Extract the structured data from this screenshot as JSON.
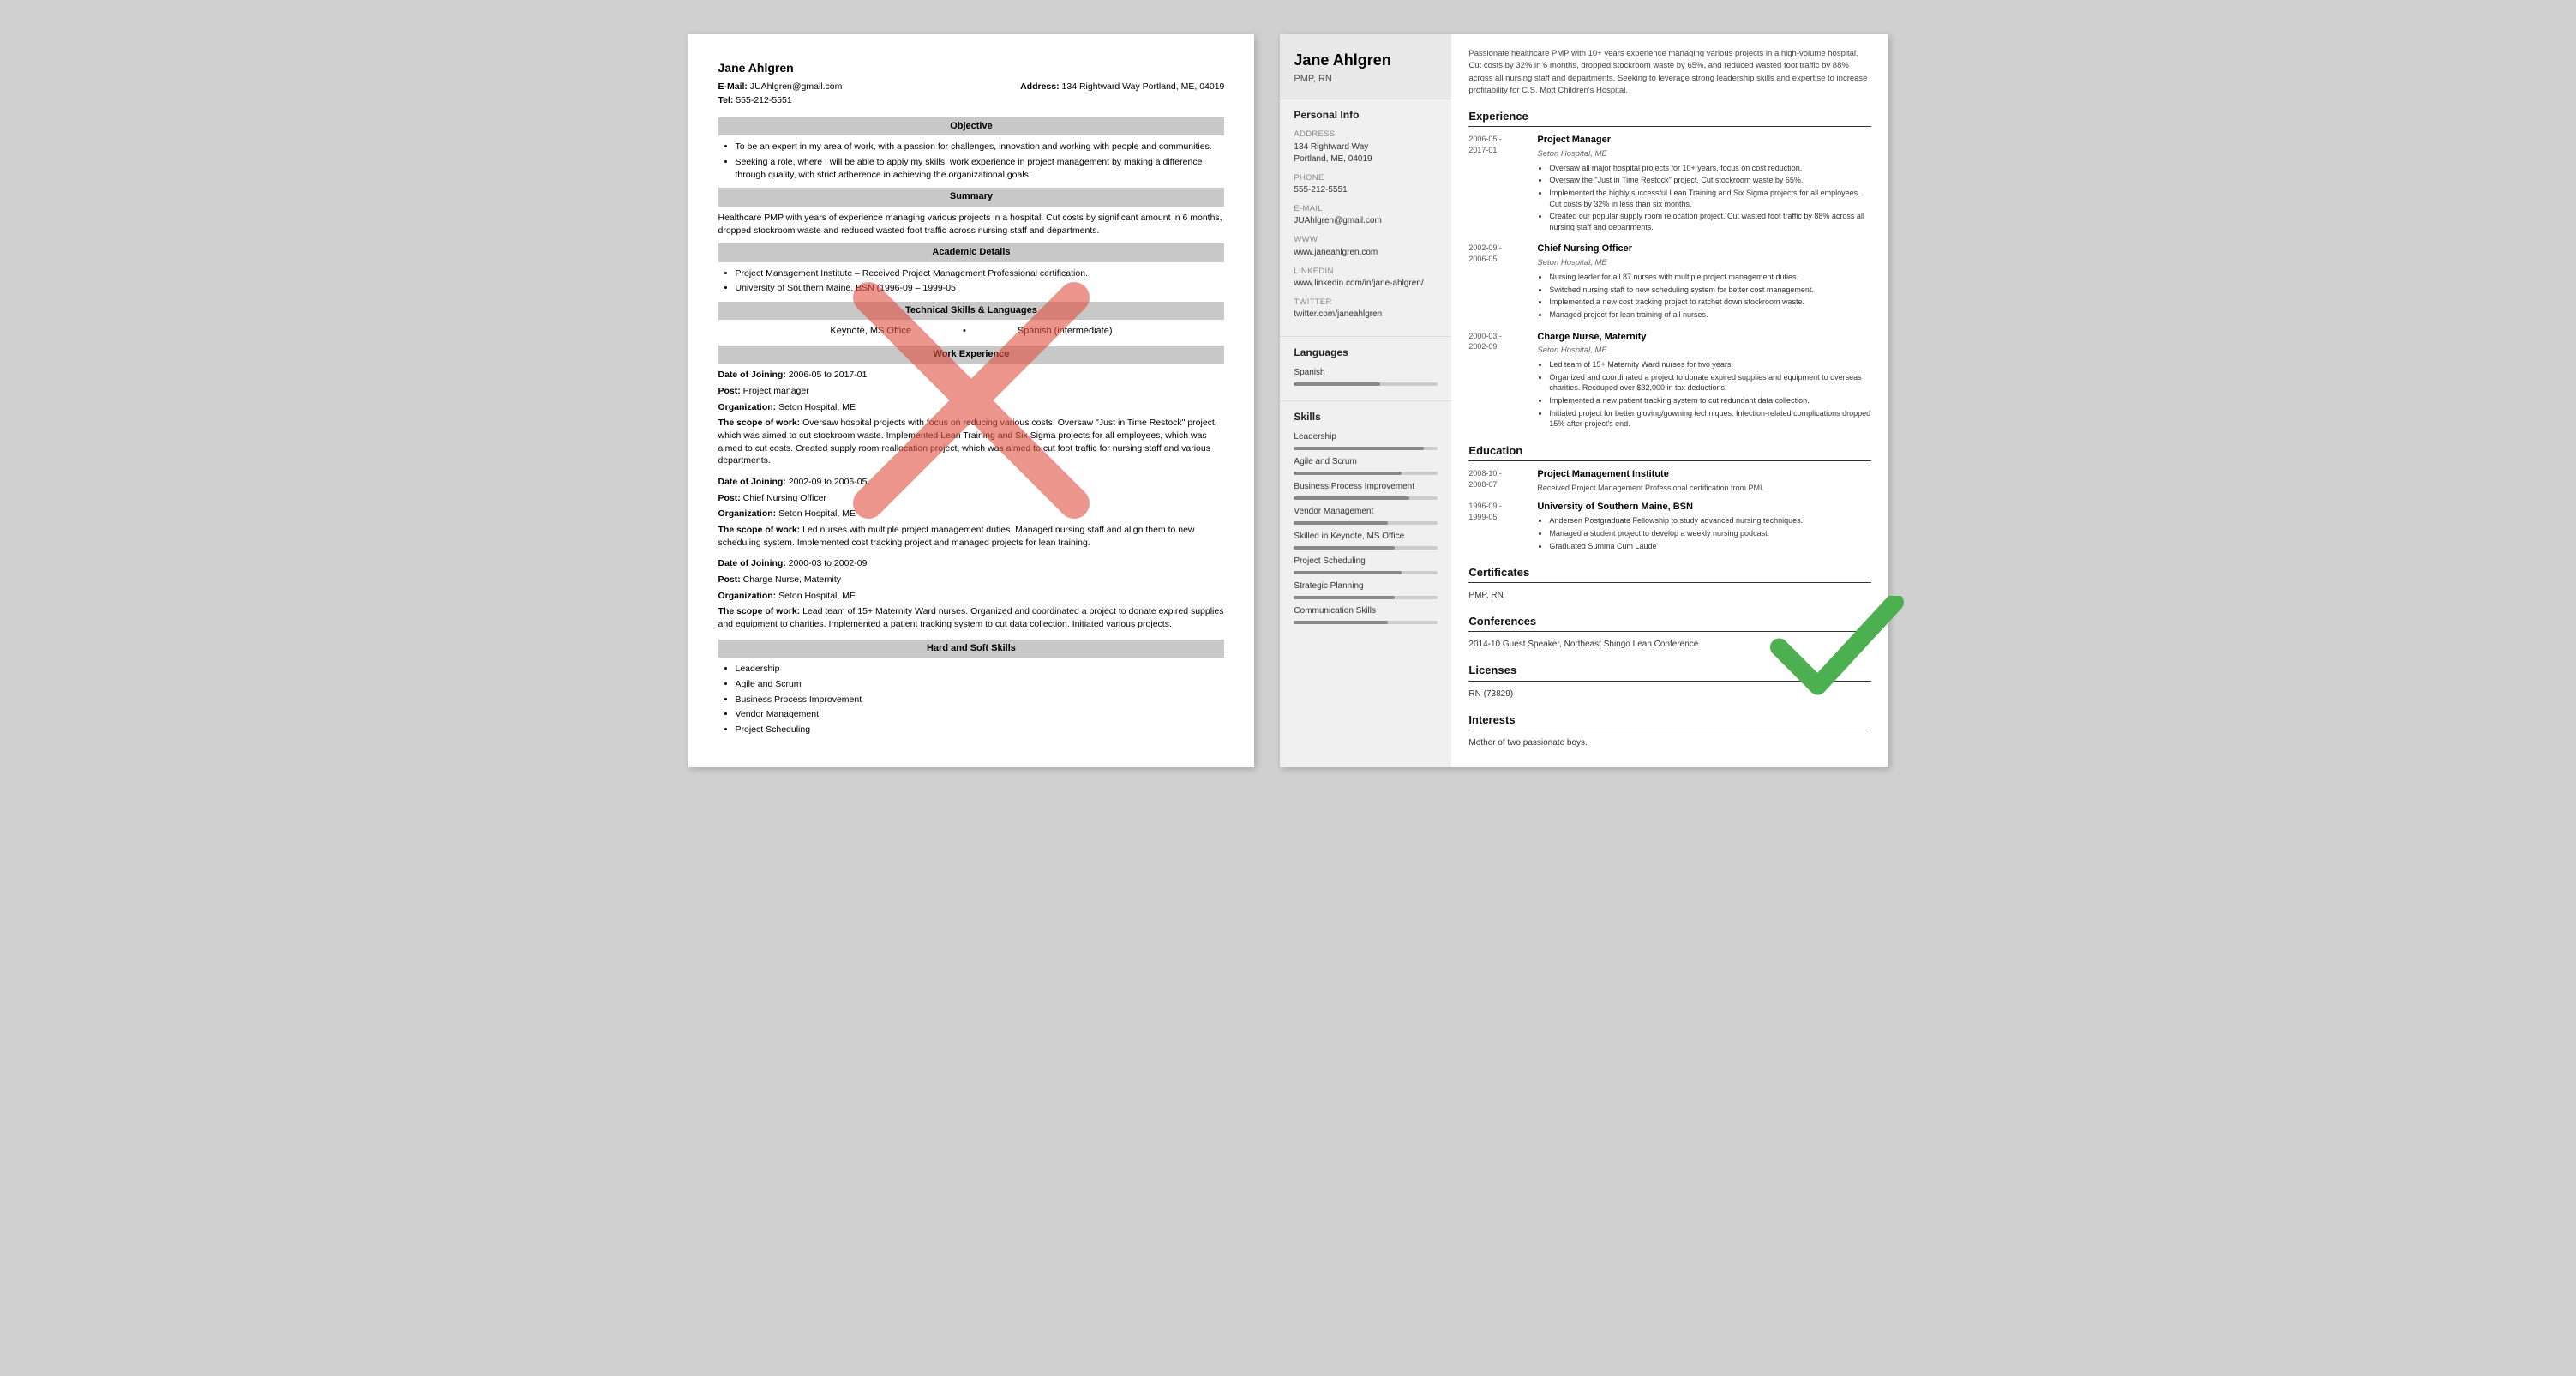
{
  "left_resume": {
    "name": "Jane Ahlgren",
    "email_label": "E-Mail:",
    "email": "JUAhlgren@gmail.com",
    "address_label": "Address:",
    "address": "134 Rightward Way Portland, ME, 04019",
    "tel_label": "Tel:",
    "tel": "555-212-5551",
    "sections": {
      "objective": {
        "title": "Objective",
        "bullets": [
          "To be an expert in my area of work, with a passion for challenges, innovation and working with people and communities.",
          "Seeking a role, where I will be able to apply my skills, work experience in project management by making a difference through quality, with strict adherence in achieving the organizational goals."
        ]
      },
      "summary": {
        "title": "Summary",
        "text": "Healthcare PMP with years of experience managing various projects in a hospital. Cut costs by significant amount in 6 months, dropped stockroom waste and reduced wasted foot traffic across nursing staff and departments."
      },
      "academic": {
        "title": "Academic Details",
        "bullets": [
          "Project Management Institute – Received Project Management Professional certification.",
          "University of Southern Maine, BSN (1996-09 – 1999-05"
        ]
      },
      "technical": {
        "title": "Technical Skills & Languages",
        "skill1": "Keynote, MS Office",
        "skill2": "Spanish (intermediate)"
      },
      "work": {
        "title": "Work Experience",
        "entries": [
          {
            "date_label": "Date of Joining:",
            "date": "2006-05 to 2017-01",
            "post_label": "Post:",
            "post": "Project manager",
            "org_label": "Organization:",
            "org": "Seton Hospital, ME",
            "scope_label": "The scope of work:",
            "scope": "Oversaw hospital projects with focus on reducing various costs. Oversaw \"Just in Time Restock\" project, which was aimed to cut stockroom waste. Implemented Lean Training and Six Sigma projects for all employees, which was aimed to cut costs. Created supply room reallocation project, which was aimed to cut foot traffic for nursing staff and various departments."
          },
          {
            "date_label": "Date of Joining:",
            "date": "2002-09 to 2006-05",
            "post_label": "Post:",
            "post": "Chief Nursing Officer",
            "org_label": "Organization:",
            "org": "Seton Hospital, ME",
            "scope_label": "The scope of work:",
            "scope": "Led nurses with multiple project management duties. Managed nursing staff and align them to new scheduling system. Implemented cost tracking project and managed projects for lean training."
          },
          {
            "date_label": "Date of Joining:",
            "date": "2000-03 to 2002-09",
            "post_label": "Post:",
            "post": "Charge Nurse, Maternity",
            "org_label": "Organization:",
            "org": "Seton Hospital, ME",
            "scope_label": "The scope of work:",
            "scope": "Lead team of 15+ Maternity Ward nurses. Organized and coordinated a project to donate expired supplies and equipment to charities. Implemented a patient tracking system to cut data collection. Initiated various projects."
          }
        ]
      },
      "hard_soft": {
        "title": "Hard and Soft Skills",
        "bullets": [
          "Leadership",
          "Agile and Scrum",
          "Business Process Improvement",
          "Vendor Management",
          "Project Scheduling"
        ]
      }
    }
  },
  "right_resume": {
    "name": "Jane Ahlgren",
    "title": "PMP, RN",
    "summary": "Passionate healthcare PMP with 10+ years experience managing various projects in a high-volume hospital. Cut costs by 32% in 6 months, dropped stockroom waste by 65%, and reduced wasted foot traffic by 88% across all nursing staff and departments. Seeking to leverage strong leadership skills and expertise to increase profitability for C.S. Mott Children's Hospital.",
    "sidebar": {
      "personal_info_title": "Personal Info",
      "address_label": "Address",
      "address": "134 Rightward Way\nPortland, ME, 04019",
      "phone_label": "Phone",
      "phone": "555-212-5551",
      "email_label": "E-mail",
      "email": "JUAhlgren@gmail.com",
      "www_label": "www",
      "www": "www.janeahlgren.com",
      "linkedin_label": "LinkedIn",
      "linkedin": "www.linkedin.com/in/jane-ahlgren/",
      "twitter_label": "Twitter",
      "twitter": "twitter.com/janeahlgren",
      "languages_title": "Languages",
      "languages": [
        {
          "name": "Spanish",
          "level": 60
        }
      ],
      "skills_title": "Skills",
      "skills": [
        {
          "name": "Leadership",
          "level": 90
        },
        {
          "name": "Agile and Scrum",
          "level": 75
        },
        {
          "name": "Business Process Improvement",
          "level": 80
        },
        {
          "name": "Vendor Management",
          "level": 65
        },
        {
          "name": "Skilled in Keynote, MS Office",
          "level": 70
        },
        {
          "name": "Project Scheduling",
          "level": 75
        },
        {
          "name": "Strategic Planning",
          "level": 70
        },
        {
          "name": "Communication Skills",
          "level": 65
        }
      ]
    },
    "main": {
      "experience_title": "Experience",
      "entries": [
        {
          "date": "2006-05 -\n2017-01",
          "title": "Project Manager",
          "org": "Seton Hospital, ME",
          "bullets": [
            "Oversaw all major hospital projects for 10+ years, focus on cost reduction.",
            "Oversaw the \"Just in Time Restock\" project. Cut stockroom waste by 65%.",
            "Implemented the highly successful Lean Training and Six Sigma projects for all employees. Cut costs by 32% in less than six months.",
            "Created our popular supply room relocation project. Cut wasted foot traffic by 88% across all nursing staff and departments."
          ]
        },
        {
          "date": "2002-09 -\n2006-05",
          "title": "Chief Nursing Officer",
          "org": "Seton Hospital, ME",
          "bullets": [
            "Nursing leader for all 87 nurses with multiple project management duties.",
            "Switched nursing staff to new scheduling system for better cost management.",
            "Implemented a new cost tracking project to ratchet down stockroom waste.",
            "Managed project for lean training of all nurses."
          ]
        },
        {
          "date": "2000-03 -\n2002-09",
          "title": "Charge Nurse, Maternity",
          "org": "Seton Hospital, ME",
          "bullets": [
            "Led team of 15+ Maternity Ward nurses for two years.",
            "Organized and coordinated a project to donate expired supplies and equipment to overseas charities. Recouped over $32,000 in tax deductions.",
            "Implemented a new patient tracking system to cut redundant data collection.",
            "Initiated project for better gloving/gowning techniques. Infection-related complications dropped 15% after project's end."
          ]
        }
      ],
      "education_title": "Education",
      "education": [
        {
          "date": "2008-10 -\n2008-07",
          "degree": "Project Management Institute",
          "desc": "Received Project Management Professional certification from PMI."
        },
        {
          "date": "1996-09 -\n1999-05",
          "degree": "University of Southern Maine, BSN",
          "bullets": [
            "Andersen Postgraduate Fellowship to study advanced nursing techniques.",
            "Managed a student project to develop a weekly nursing podcast.",
            "Graduated Summa Cum Laude"
          ]
        }
      ],
      "certificates_title": "Certificates",
      "certificates": "PMP, RN",
      "conferences_title": "Conferences",
      "conferences": "2014-10   Guest Speaker, Northeast Shingo Lean Conference",
      "licenses_title": "Licenses",
      "licenses": "RN (73829)",
      "interests_title": "Interests",
      "interests": "Mother of two passionate boys."
    }
  }
}
